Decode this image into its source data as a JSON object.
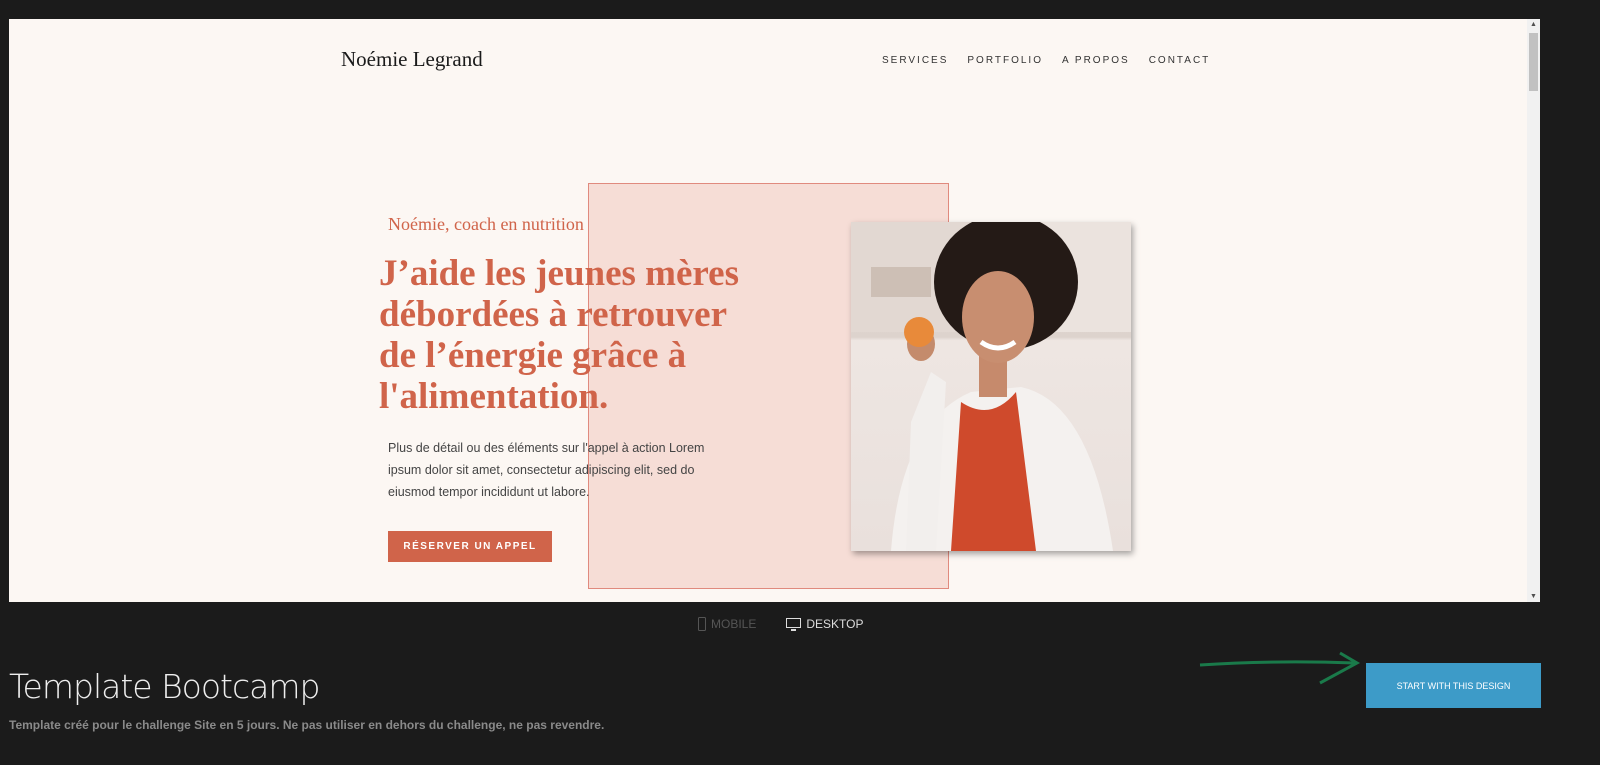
{
  "site": {
    "logo": "Noémie Legrand",
    "nav": [
      "SERVICES",
      "PORTFOLIO",
      "A PROPOS",
      "CONTACT"
    ],
    "hero": {
      "subtitle": "Noémie, coach en nutrition",
      "headline": "J’aide les jeunes mères  débordées à retrouver de l’énergie grâce à l'alimentation.",
      "body": "Plus de détail ou des éléments sur l'appel à action Lorem ipsum dolor sit amet, consectetur adipiscing elit, sed do eiusmod tempor incididunt ut labore.",
      "cta": "RÉSERVER UN APPEL"
    },
    "colors": {
      "accent": "#d0644a",
      "background": "#fcf7f3",
      "panel": "#f6ddd6"
    }
  },
  "preview": {
    "mobile": "MOBILE",
    "desktop": "DESKTOP"
  },
  "template": {
    "title": "Template Bootcamp",
    "description": "Template créé pour le challenge Site en 5 jours. Ne pas utiliser en dehors du challenge, ne pas revendre.",
    "start_button": "START WITH THIS DESIGN",
    "button_color": "#3d9bc8"
  }
}
